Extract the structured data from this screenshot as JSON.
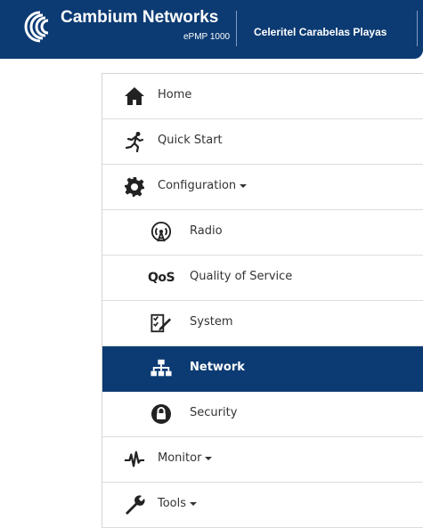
{
  "header": {
    "brand_name": "Cambium Networks",
    "model": "ePMP 1000",
    "site_name": "Celeritel Carabelas Playas",
    "background_color": "#0c3b73"
  },
  "menu": {
    "items": [
      {
        "label": "Home",
        "icon": "home-icon",
        "level": "top"
      },
      {
        "label": "Quick Start",
        "icon": "running-person-icon",
        "level": "top"
      },
      {
        "label": "Configuration",
        "icon": "gear-icon",
        "level": "top",
        "expanded": true
      },
      {
        "label": "Radio",
        "icon": "radio-antenna-icon",
        "level": "sub"
      },
      {
        "label": "Quality of Service",
        "icon": "qos-icon",
        "icon_text": "QoS",
        "level": "sub"
      },
      {
        "label": "System",
        "icon": "system-checklist-icon",
        "level": "sub"
      },
      {
        "label": "Network",
        "icon": "network-icon",
        "level": "sub",
        "active": true
      },
      {
        "label": "Security",
        "icon": "lock-icon",
        "level": "sub"
      },
      {
        "label": "Monitor",
        "icon": "pulse-icon",
        "level": "top"
      },
      {
        "label": "Tools",
        "icon": "wrench-icon",
        "level": "top"
      }
    ],
    "active_color": "#0c3b73"
  }
}
